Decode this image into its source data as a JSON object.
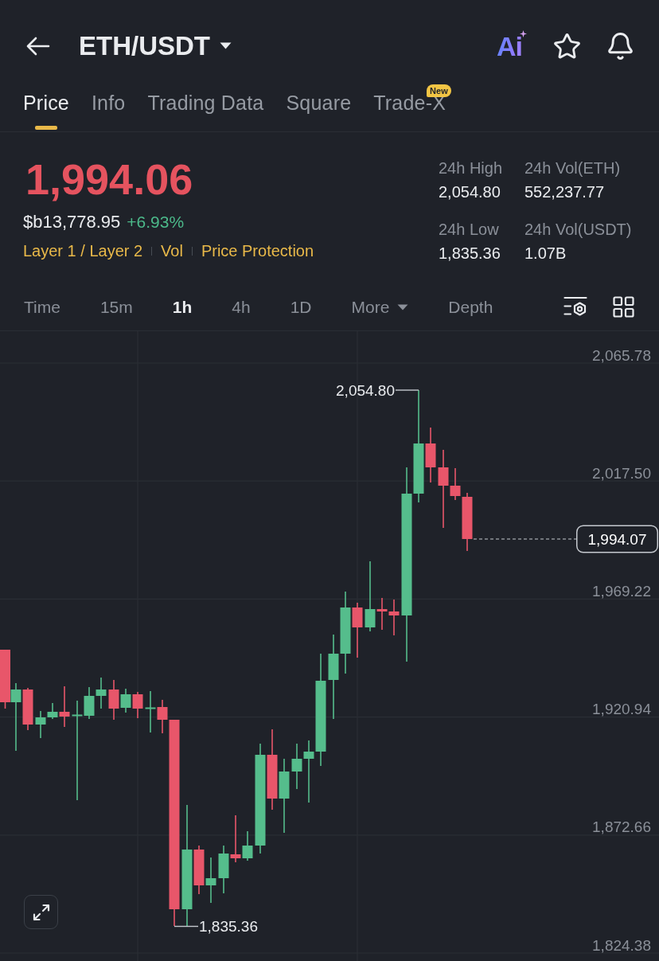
{
  "header": {
    "title": "ETH/USDT",
    "ai_label": "Ai"
  },
  "tabs": [
    {
      "label": "Price",
      "selected": true
    },
    {
      "label": "Info",
      "selected": false
    },
    {
      "label": "Trading Data",
      "selected": false
    },
    {
      "label": "Square",
      "selected": false
    },
    {
      "label": "Trade-X",
      "selected": false,
      "badge": "New"
    }
  ],
  "ticker": {
    "price": "1,994.06",
    "fiat_value": "$b13,778.95",
    "change": "+6.93%",
    "tags": [
      "Layer 1 / Layer 2",
      "Vol",
      "Price Protection"
    ]
  },
  "stats": [
    {
      "label": "24h High",
      "value": "2,054.80"
    },
    {
      "label": "24h Vol(ETH)",
      "value": "552,237.77"
    },
    {
      "label": "24h Low",
      "value": "1,835.36"
    },
    {
      "label": "24h Vol(USDT)",
      "value": "1.07B"
    }
  ],
  "intervals": [
    {
      "label": "Time",
      "kind": "option",
      "selected": false
    },
    {
      "label": "15m",
      "kind": "option",
      "selected": false
    },
    {
      "label": "1h",
      "kind": "option",
      "selected": true
    },
    {
      "label": "4h",
      "kind": "option",
      "selected": false
    },
    {
      "label": "1D",
      "kind": "option",
      "selected": false
    },
    {
      "label": "More",
      "kind": "menu",
      "selected": false
    },
    {
      "label": "Depth",
      "kind": "option",
      "selected": false
    }
  ],
  "chart": {
    "price_scale": [
      "2,065.78",
      "2,017.50",
      "1,969.22",
      "1,920.94",
      "1,872.66",
      "1,824.38"
    ],
    "high_label": "2,054.80",
    "low_label": "1,835.36",
    "last_price": "1,994.07"
  }
}
